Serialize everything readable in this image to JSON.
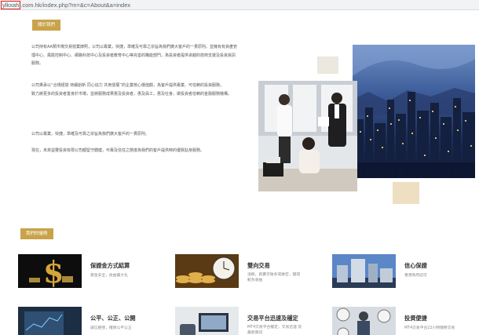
{
  "browser": {
    "url_host": "ylkxah",
    "url_rest": ".com.hk/index.php?m=&c=About&a=index"
  },
  "about": {
    "tag": "關於我們",
    "paragraphs": [
      "公司持有AA類市場交易營業牌照，公司以專業，快捷，準確及可靠之宗旨為我們廣大客戶的一貫原則。並擁有有資產管理中心、風險控制中心、網路科技中心及投資者教育中心等完善的職能部門，為投資者提供卓越的技術支援及投資資訊服務。",
      "公司秉承以“合規經營 持續創新 同心協力 共用發展”的企業核心價值觀，為客戶提供專業、可信賴的投資服務，\n致力將更多的投資者置身於市場，並將服務成果惠及投資者，惠及員工，惠及社會，做投資者信賴的金融服務機構。",
      "公司以專業，快捷，準確及可靠之宗旨為我們廣大客戶的一貫原則。",
      "現在，未來益豐投資有限公司都堅守體健，可專及信任之態度為我們的客戶提供時的優質貼身服務。"
    ]
  },
  "advantages": {
    "tag": "我們的優勢",
    "items": [
      {
        "title": "保證金方式結算",
        "desc": "資金安全，收益最大化"
      },
      {
        "title": "雙向交易",
        "desc": "漲跌，買賣可做多或做空，獲得\n較多收益"
      },
      {
        "title": "信心保證",
        "desc": "香港政府認可"
      },
      {
        "title": "公平、公正、公開",
        "desc": "誠信經營，確保公平公正"
      },
      {
        "title": "交易平台迅速及穩定",
        "desc": "MT4交易平台穩定，交易迅速 及\n最新資訊"
      },
      {
        "title": "投資便捷",
        "desc": "MT4交易平台22小時隨時交易"
      }
    ]
  },
  "colors": {
    "gold": "#c9a24a",
    "url_highlight": "#e0201e"
  }
}
